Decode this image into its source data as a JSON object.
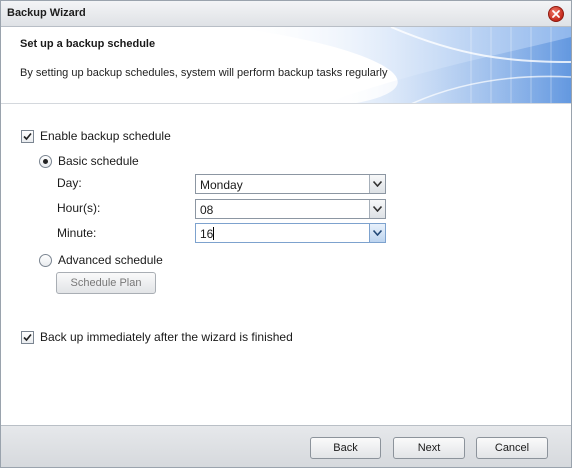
{
  "window": {
    "title": "Backup Wizard"
  },
  "header": {
    "title": "Set up a backup schedule",
    "description": "By setting up backup schedules, system will perform backup tasks regularly"
  },
  "options": {
    "enable_schedule": {
      "label": "Enable backup schedule",
      "checked": true
    },
    "basic_schedule": {
      "label": "Basic schedule",
      "selected": true
    },
    "day": {
      "label": "Day:",
      "value": "Monday"
    },
    "hours": {
      "label": "Hour(s):",
      "value": "08"
    },
    "minute": {
      "label": "Minute:",
      "value": "16"
    },
    "advanced_schedule": {
      "label": "Advanced schedule",
      "selected": false
    },
    "schedule_plan_label": "Schedule Plan",
    "backup_immediately": {
      "label": "Back up immediately after the wizard is finished",
      "checked": true
    }
  },
  "footer": {
    "back_label": "Back",
    "next_label": "Next",
    "cancel_label": "Cancel"
  },
  "colors": {
    "accent": "#7da2ce",
    "close": "#c4281a",
    "banner": "#3f7fd6"
  },
  "icons": {
    "close": "close-icon",
    "dropdown": "chevron-down-icon",
    "check": "checkmark-icon"
  }
}
